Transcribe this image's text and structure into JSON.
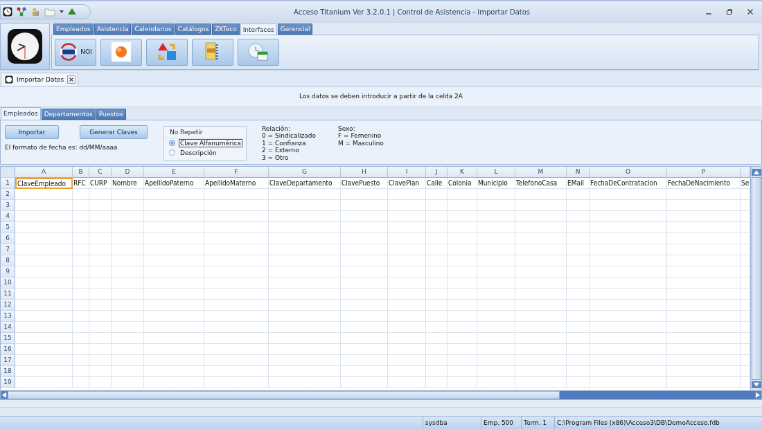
{
  "window": {
    "title": "Acceso Titanium  Ver 3.2.0.1 | Control de Asistencia - Importar Datos"
  },
  "ribbon": {
    "tabs": [
      {
        "label": "Empleados",
        "selected": false
      },
      {
        "label": "Asistencia",
        "selected": false
      },
      {
        "label": "Calendarios",
        "selected": false
      },
      {
        "label": "Catálogos",
        "selected": false
      },
      {
        "label": "ZKTeco",
        "selected": false
      },
      {
        "label": "Interfaces",
        "selected": true
      },
      {
        "label": "Gerencial",
        "selected": false
      }
    ],
    "buttons": [
      {
        "kind": "noi",
        "label": "NOI"
      },
      {
        "kind": "sphere"
      },
      {
        "kind": "shapes"
      },
      {
        "kind": "document"
      },
      {
        "kind": "clock"
      }
    ]
  },
  "document_tab": {
    "label": "Importar Datos"
  },
  "notice": "Los datos se deben introducir a partir de la celda 2A",
  "sheet_tabs": [
    {
      "label": "Empleados",
      "selected": true
    },
    {
      "label": "Departamentos",
      "selected": false
    },
    {
      "label": "Puestos",
      "selected": false
    }
  ],
  "actions": {
    "import_button": "Importar",
    "generate_button": "Generar Claves",
    "date_format": "El formato de fecha es: dd/MM/aaaa"
  },
  "no_repeat": {
    "title": "No Repetir",
    "options": [
      {
        "label": "Clave Alfanumérica",
        "selected": true
      },
      {
        "label": "Descripción",
        "selected": false
      }
    ]
  },
  "legends": [
    {
      "title": "Relación:",
      "lines": [
        "0 = Sindicalizado",
        "1 = Confianza",
        "2 = Externo",
        "3 = Otro"
      ]
    },
    {
      "title": "Sexo:",
      "lines": [
        "F = Femenino",
        "M = Masculino"
      ]
    }
  ],
  "grid": {
    "columns": [
      {
        "letter": "A",
        "header": "ClaveEmpleado",
        "selected": true
      },
      {
        "letter": "B",
        "header": "RFC",
        "selected": false
      },
      {
        "letter": "C",
        "header": "CURP",
        "selected": false
      },
      {
        "letter": "D",
        "header": "Nombre",
        "selected": false
      },
      {
        "letter": "E",
        "header": "ApellidoPaterno",
        "selected": false
      },
      {
        "letter": "F",
        "header": "ApellidoMaterno",
        "selected": false
      },
      {
        "letter": "G",
        "header": "ClaveDepartamento",
        "selected": false
      },
      {
        "letter": "H",
        "header": "ClavePuesto",
        "selected": false
      },
      {
        "letter": "I",
        "header": "ClavePlan",
        "selected": false
      },
      {
        "letter": "J",
        "header": "Calle",
        "selected": false
      },
      {
        "letter": "K",
        "header": "Colonia",
        "selected": false
      },
      {
        "letter": "L",
        "header": "Municipio",
        "selected": false
      },
      {
        "letter": "M",
        "header": "TelefonoCasa",
        "selected": false
      },
      {
        "letter": "N",
        "header": "EMail",
        "selected": false
      },
      {
        "letter": "O",
        "header": "FechaDeContratacion",
        "selected": false
      },
      {
        "letter": "P",
        "header": "FechaDeNacimiento",
        "selected": false
      },
      {
        "header": "Se",
        "selected": false
      }
    ],
    "row_numbers": [
      "1",
      "2",
      "3",
      "4",
      "5",
      "6",
      "7",
      "8",
      "9",
      "10",
      "11",
      "12",
      "13",
      "14",
      "15",
      "16",
      "17",
      "18",
      "19"
    ]
  },
  "status_bar": [
    "sysdba",
    "Emp. 500",
    "Term. 1",
    "C:\\Program Files (x86)\\Acceso3\\DB\\DemoAcceso.fdb"
  ]
}
